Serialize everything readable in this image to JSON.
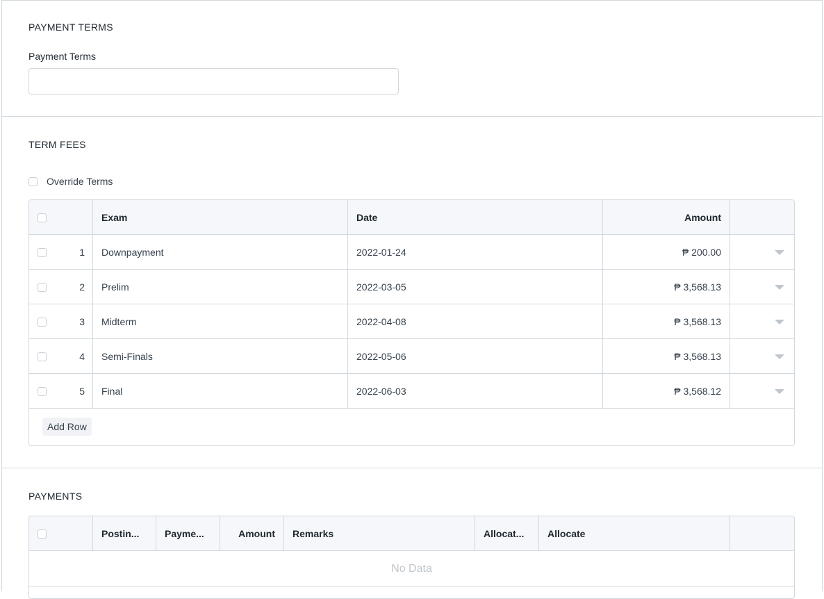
{
  "payment_terms_section": {
    "heading": "PAYMENT TERMS",
    "field_label": "Payment Terms",
    "field_value": ""
  },
  "term_fees_section": {
    "heading": "TERM FEES",
    "override_label": "Override Terms",
    "columns": {
      "exam": "Exam",
      "date": "Date",
      "amount": "Amount"
    },
    "rows": [
      {
        "num": "1",
        "exam": "Downpayment",
        "date": "2022-01-24",
        "amount": "₱ 200.00"
      },
      {
        "num": "2",
        "exam": "Prelim",
        "date": "2022-03-05",
        "amount": "₱ 3,568.13"
      },
      {
        "num": "3",
        "exam": "Midterm",
        "date": "2022-04-08",
        "amount": "₱ 3,568.13"
      },
      {
        "num": "4",
        "exam": "Semi-Finals",
        "date": "2022-05-06",
        "amount": "₱ 3,568.13"
      },
      {
        "num": "5",
        "exam": "Final",
        "date": "2022-06-03",
        "amount": "₱ 3,568.12"
      }
    ],
    "add_row_label": "Add Row"
  },
  "payments_section": {
    "heading": "PAYMENTS",
    "columns": {
      "posting": "Postin...",
      "payment": "Payme...",
      "amount": "Amount",
      "remarks": "Remarks",
      "allocated": "Allocat...",
      "allocate": "Allocate"
    },
    "empty_text": "No Data"
  }
}
